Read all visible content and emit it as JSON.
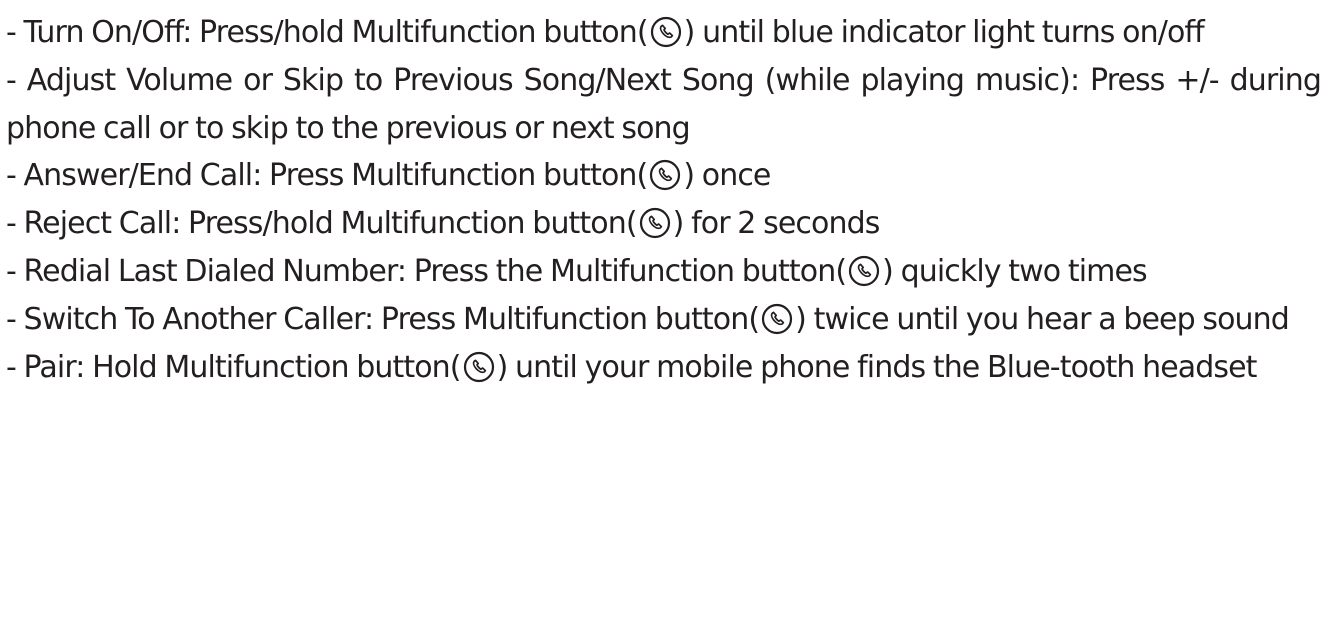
{
  "instructions": [
    {
      "before": "- Turn On/Off: Press/hold Multifunction button(",
      "after": ") until blue indicator light turns on/off"
    },
    {
      "text": "- Adjust Volume or Skip to Previous Song/Next Song (while playing music): Press +/- during phone call or to skip to the previous or next song"
    },
    {
      "before": "- Answer/End Call: Press Multifunction button(",
      "after": ") once"
    },
    {
      "before": "- Reject Call: Press/hold Multifunction button(",
      "after": ") for 2 seconds"
    },
    {
      "before": "- Redial Last Dialed Number: Press the Multifunction button(",
      "after": ") quickly two times"
    },
    {
      "before": "- Switch To Another Caller: Press Multifunction button(",
      "after": ") twice until you hear a beep sound"
    },
    {
      "before": "- Pair: Hold Multifunction button(",
      "after": ") until your mobile phone finds the Blue-tooth headset"
    }
  ],
  "icon": {
    "name": "multifunction-phone-icon",
    "color": "#231f20"
  },
  "text_color": "#231f20",
  "background": "#ffffff"
}
